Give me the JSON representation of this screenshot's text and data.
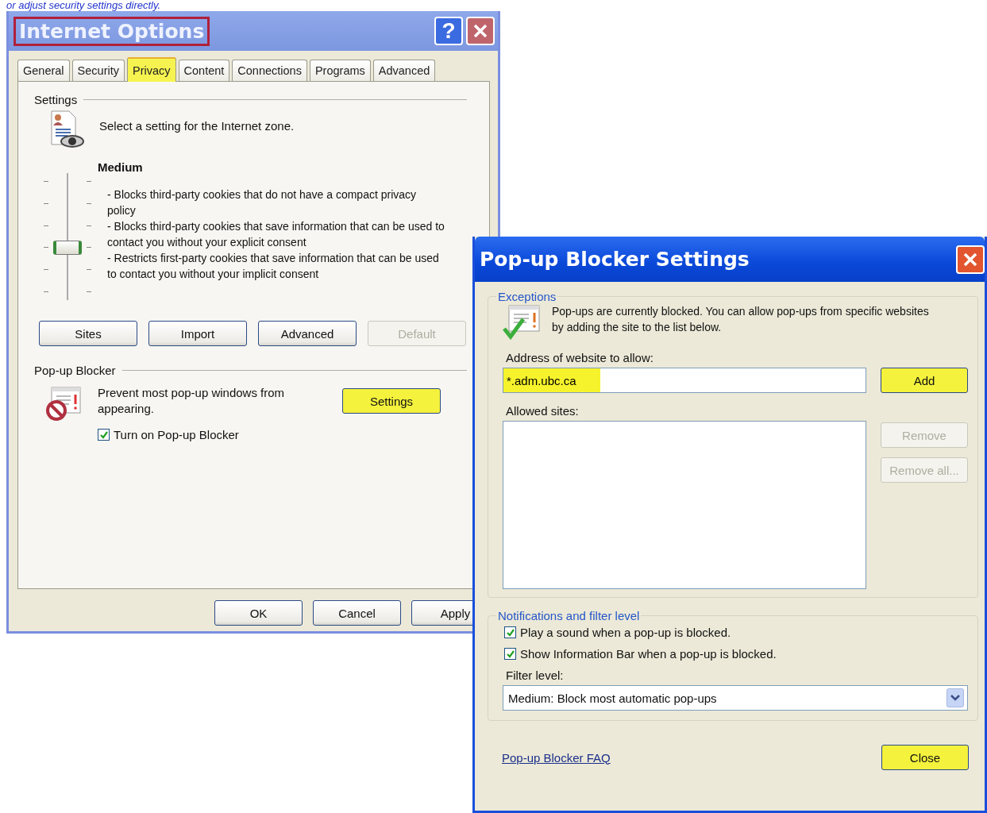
{
  "caption": "or adjust security settings directly.",
  "internet_options": {
    "title": "Internet Options",
    "title_highlighted": true,
    "help_button": "?",
    "tabs": [
      {
        "label": "General",
        "selected": false
      },
      {
        "label": "Security",
        "selected": false
      },
      {
        "label": "Privacy",
        "selected": true
      },
      {
        "label": "Content",
        "selected": false
      },
      {
        "label": "Connections",
        "selected": false
      },
      {
        "label": "Programs",
        "selected": false
      },
      {
        "label": "Advanced",
        "selected": false
      }
    ],
    "settings": {
      "heading": "Settings",
      "intro": "Select a setting for the Internet zone.",
      "level_name": "Medium",
      "level": 0.4,
      "description": [
        "- Blocks third-party cookies that do not have a compact privacy policy",
        "- Blocks third-party cookies that save information that can be used to contact you without your explicit consent",
        "- Restricts first-party cookies that save information that can be used to contact you without your implicit consent"
      ]
    },
    "buttons": [
      {
        "label": "Sites",
        "disabled": false
      },
      {
        "label": "Import",
        "disabled": false
      },
      {
        "label": "Advanced",
        "disabled": false
      },
      {
        "label": "Default",
        "disabled": true
      }
    ],
    "popup_blocker": {
      "heading": "Pop-up Blocker",
      "text": "Prevent most pop-up windows from appearing.",
      "settings_button": {
        "label": "Settings",
        "highlighted": true
      },
      "checkbox": {
        "label": "Turn on Pop-up Blocker",
        "checked": true
      }
    },
    "footer_buttons": [
      "OK",
      "Cancel",
      "Apply"
    ]
  },
  "popup_settings": {
    "title": "Pop-up Blocker Settings",
    "exceptions": {
      "heading": "Exceptions",
      "text": "Pop-ups are currently blocked.  You can allow pop-ups from specific websites by adding the site to the list below.",
      "address_label": "Address of website to allow:",
      "address_value": "*.adm.ubc.ca",
      "address_highlighted": true,
      "add_button": {
        "label": "Add",
        "highlighted": true
      },
      "allowed_label": "Allowed sites:",
      "side_buttons": [
        {
          "label": "Remove",
          "disabled": true
        },
        {
          "label": "Remove all...",
          "disabled": true
        }
      ]
    },
    "notifications": {
      "heading": "Notifications and filter level",
      "checkboxes": [
        {
          "label": "Play a sound when a pop-up is blocked.",
          "checked": true
        },
        {
          "label": "Show Information Bar when a pop-up is blocked.",
          "checked": true
        }
      ],
      "filter_label": "Filter level:",
      "filter_value": "Medium: Block most automatic pop-ups"
    },
    "faq_link": "Pop-up Blocker FAQ",
    "close_button": {
      "label": "Close",
      "highlighted": true
    }
  }
}
